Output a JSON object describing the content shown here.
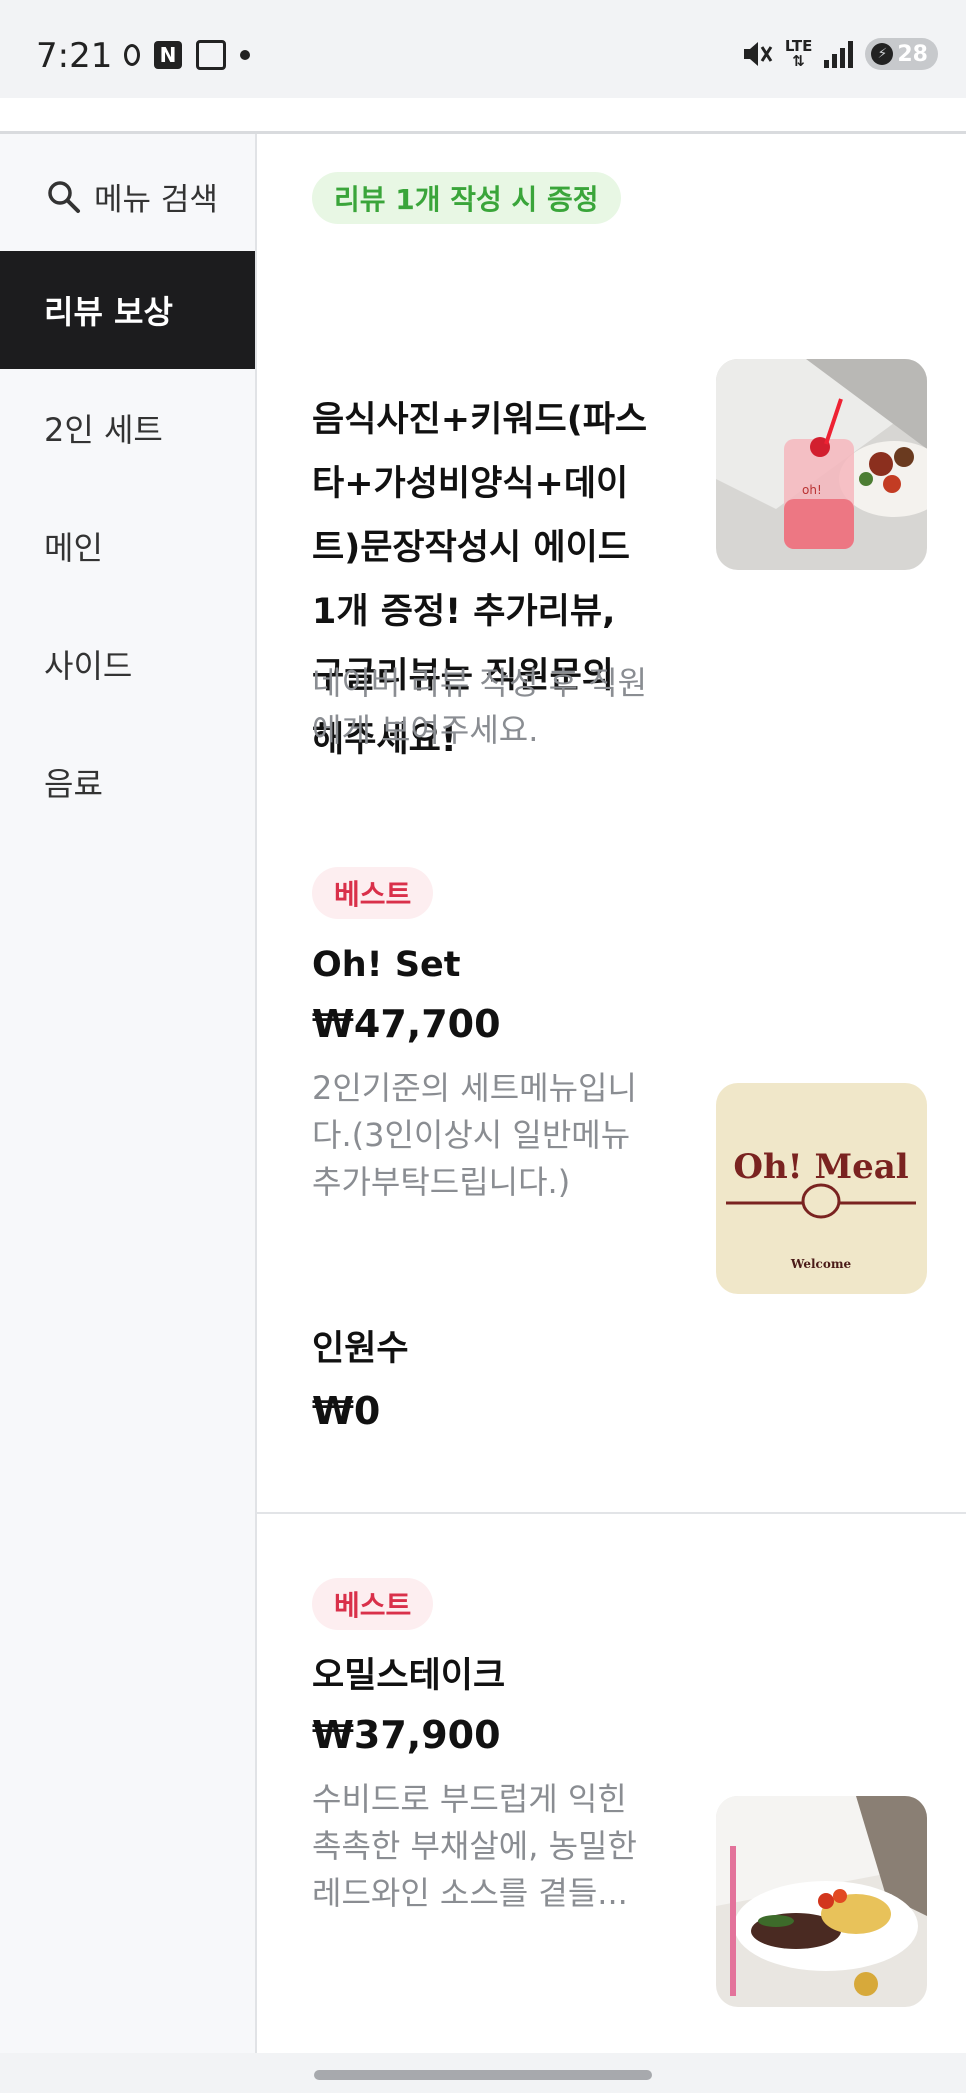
{
  "status_bar": {
    "time": "7:21",
    "n_label": "N",
    "lte": "LTE",
    "battery": "28"
  },
  "sidebar": {
    "search_label": "메뉴 검색",
    "categories": [
      {
        "label": "리뷰 보상",
        "active": true
      },
      {
        "label": "2인 세트",
        "active": false
      },
      {
        "label": "메인",
        "active": false
      },
      {
        "label": "사이드",
        "active": false
      },
      {
        "label": "음료",
        "active": false
      }
    ]
  },
  "items": [
    {
      "badge": "리뷰 1개 작성 시 증정",
      "title": "음식사진+키워드(파스타+가성비양식+데이트)문장작성시 에이드 1개 증정! 추가리뷰, 구글리뷰는 직원문의 해주세요!",
      "description": "네이버 리뷰 작성 후 직원에게 보여주세요."
    },
    {
      "badge": "베스트",
      "title": "Oh! Set",
      "price": "₩47,700",
      "description": "2인기준의 세트메뉴입니다.(3인이상시 일반메뉴 추가부탁드립니다.)",
      "image_text": {
        "logo": "Oh! Meal",
        "welcome": "Welcome"
      }
    },
    {
      "title": "인원수",
      "price": "₩0"
    },
    {
      "badge": "베스트",
      "title": "오밀스테이크",
      "price": "₩37,900",
      "description": "수비드로 부드럽게 익힌 촉촉한 부채살에, 농밀한 레드와인 소스를 곁들..."
    }
  ],
  "colors": {
    "active_category_bg": "#1c1c1e",
    "badge_green": "#3aa53a",
    "badge_red": "#d9304a",
    "desc_gray": "#8a8d92"
  }
}
